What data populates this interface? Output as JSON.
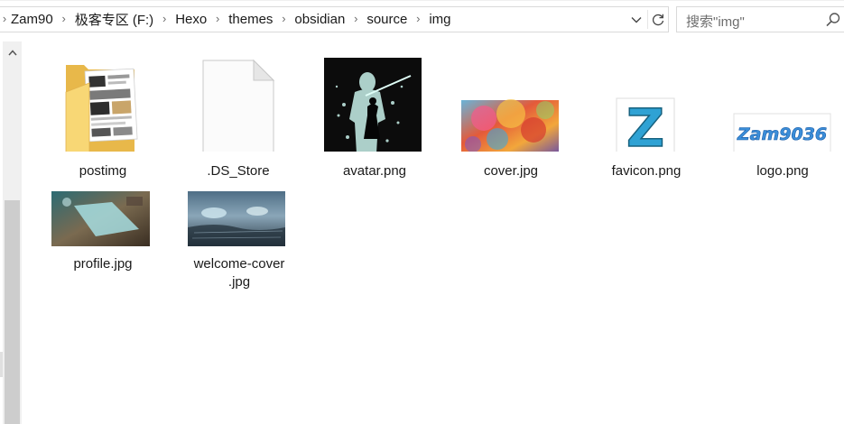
{
  "breadcrumb": {
    "segments": [
      "Zam90",
      "极客专区 (F:)",
      "Hexo",
      "themes",
      "obsidian",
      "source",
      "img"
    ]
  },
  "search": {
    "placeholder": "搜索\"img\""
  },
  "files": [
    {
      "name": "postimg",
      "type": "folder"
    },
    {
      "name": ".DS_Store",
      "type": "file"
    },
    {
      "name": "avatar.png",
      "type": "image"
    },
    {
      "name": "cover.jpg",
      "type": "image"
    },
    {
      "name": "favicon.png",
      "type": "image"
    },
    {
      "name": "logo.png",
      "type": "image"
    },
    {
      "name": "profile.jpg",
      "type": "image"
    },
    {
      "name_line1": "welcome-cover",
      "name_line2": ".jpg",
      "type": "image"
    }
  ],
  "logo_text": "Zam9036",
  "favicon_letter": "Z",
  "colors": {
    "folder": "#f8d775",
    "scrollbar_thumb": "#cdcdcd",
    "scrollbar_track": "#f0f0f0",
    "border": "#d9d9d9"
  }
}
